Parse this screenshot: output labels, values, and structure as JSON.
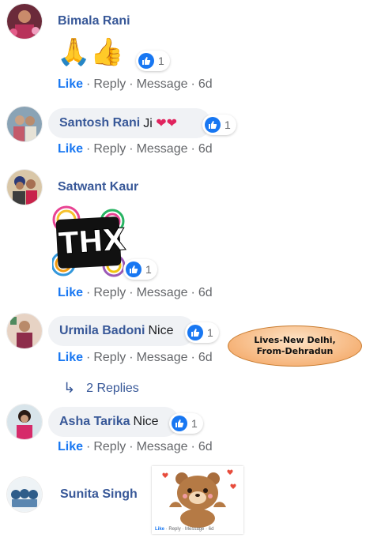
{
  "comments": [
    {
      "name": "Bimala Rani",
      "emoji": "🙏👍",
      "reaction_count": "1",
      "actions": {
        "like": "Like",
        "reply": "Reply",
        "message": "Message",
        "time": "6d"
      }
    },
    {
      "name": "Santosh Rani",
      "text": "Ji ❤❤",
      "reaction_count": "1",
      "actions": {
        "like": "Like",
        "reply": "Reply",
        "message": "Message",
        "time": "6d"
      }
    },
    {
      "name": "Satwant Kaur",
      "sticker_text": "THX",
      "reaction_count": "1",
      "actions": {
        "like": "Like",
        "reply": "Reply",
        "message": "Message",
        "time": "6d"
      }
    },
    {
      "name": "Urmila Badoni",
      "text": "Nice",
      "reaction_count": "1",
      "actions": {
        "like": "Like",
        "reply": "Reply",
        "message": "Message",
        "time": "6d"
      },
      "replies_label": "2 Replies"
    },
    {
      "name": "Asha Tarika",
      "text": "Nice",
      "reaction_count": "1",
      "actions": {
        "like": "Like",
        "reply": "Reply",
        "message": "Message",
        "time": "6d"
      }
    },
    {
      "name": "Sunita Singh",
      "mini_actions": {
        "like": "Like",
        "reply": "Reply",
        "message": "Message",
        "time": "6d"
      }
    }
  ],
  "callout": {
    "line1": "Lives-New Delhi,",
    "line2": "From-Dehradun"
  },
  "colors": {
    "link": "#385898",
    "like": "#1877f2",
    "muted": "#65676b",
    "bubble": "#f0f2f5",
    "callout": "#f6b47a"
  }
}
